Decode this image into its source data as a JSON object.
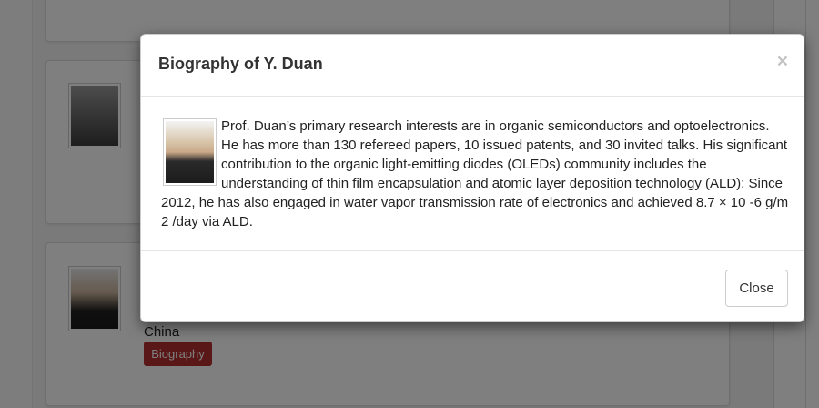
{
  "background": {
    "country": "China",
    "biography_button": "Biography"
  },
  "modal": {
    "title": "Biography of Y. Duan",
    "close_icon": "×",
    "bio": "Prof. Duan’s primary research interests are in organic semiconductors and optoelectronics. He has more than 130 refereed papers, 10 issued patents, and 30 invited talks. His significant contribution to the organic light-emitting diodes (OLEDs) community includes the understanding of thin film encapsulation and atomic layer deposition technology (ALD); Since 2012, he has also engaged in water vapor transmission rate of electronics and achieved 8.7 × 10 -6 g/m 2 /day via ALD.",
    "close_button": "Close"
  },
  "colors": {
    "biography_button": "#b52f2f",
    "backdrop": "rgba(0,0,0,0.5)"
  }
}
